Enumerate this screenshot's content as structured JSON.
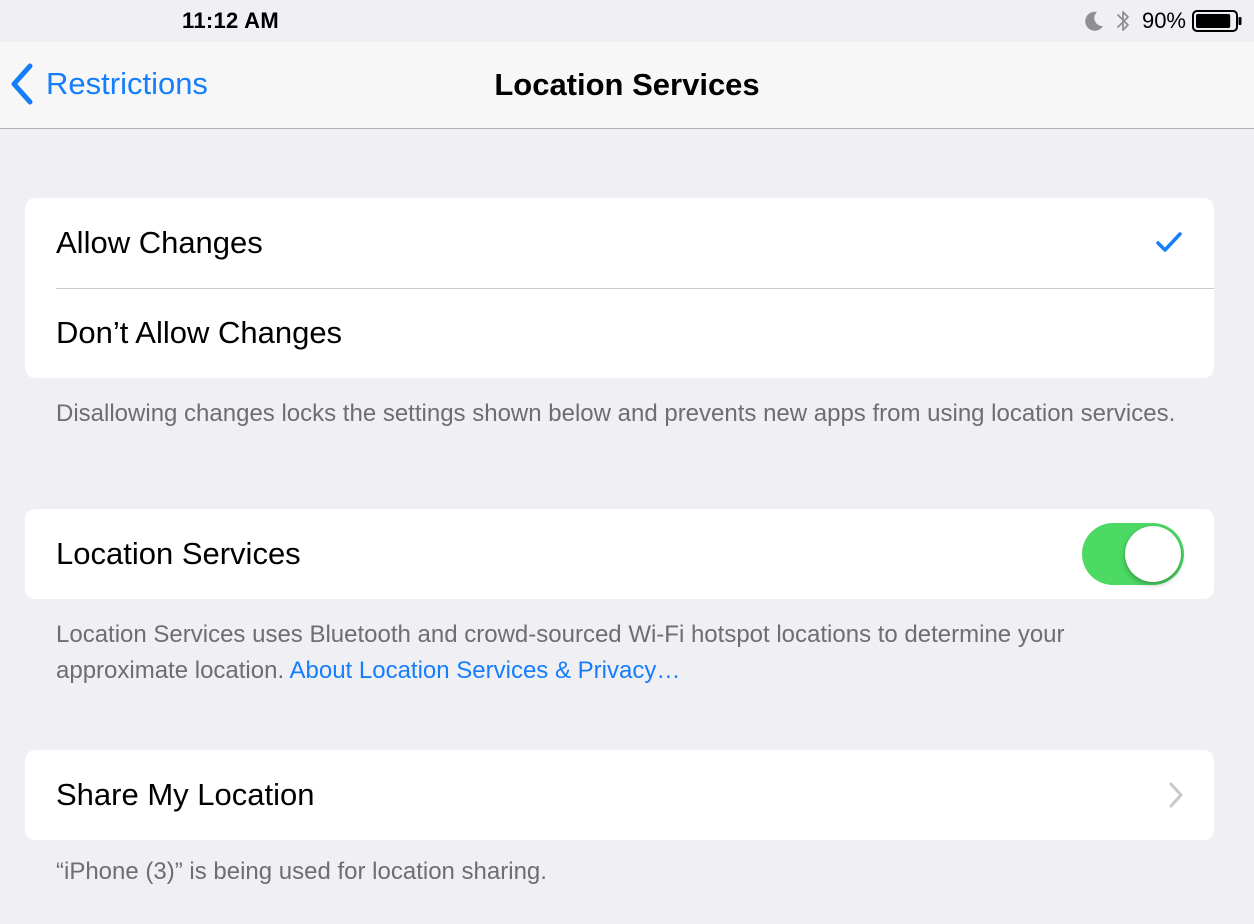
{
  "status_bar": {
    "time": "11:12 AM",
    "battery_percent": "90%",
    "battery_level": 0.9,
    "icons": [
      "moon-icon",
      "bluetooth-icon",
      "battery-icon"
    ]
  },
  "nav": {
    "back_label": "Restrictions",
    "title": "Location Services"
  },
  "restriction_group": {
    "options": [
      {
        "label": "Allow Changes",
        "selected": true
      },
      {
        "label": "Don’t Allow Changes",
        "selected": false
      }
    ],
    "footer": "Disallowing changes locks the settings shown below and prevents new apps from using location services."
  },
  "location_group": {
    "label": "Location Services",
    "toggle_on": true,
    "footer": "Location Services uses Bluetooth and crowd-sourced Wi-Fi hotspot locations to determine your approximate location. ",
    "footer_link": "About Location Services & Privacy…"
  },
  "share_group": {
    "label": "Share My Location",
    "footer": "“iPhone (3)” is being used for location sharing."
  },
  "colors": {
    "accent": "#157efb",
    "toggle_on": "#4cd964",
    "background": "#efeff4",
    "footer_text": "#6d6d72"
  }
}
